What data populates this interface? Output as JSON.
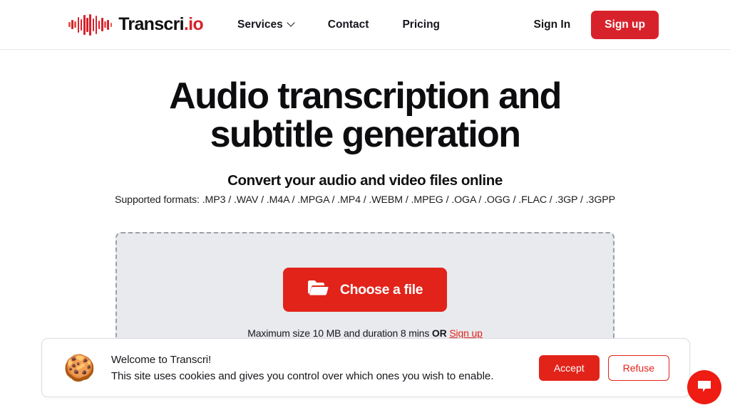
{
  "header": {
    "logo": {
      "icon": "audio-waveform-icon",
      "name_primary": "Transcri",
      "name_suffix": ".io"
    },
    "nav": [
      {
        "label": "Services",
        "icon": "chevron-down-icon",
        "has_dropdown": true
      },
      {
        "label": "Contact",
        "has_dropdown": false
      },
      {
        "label": "Pricing",
        "has_dropdown": false
      }
    ],
    "sign_in_label": "Sign In",
    "sign_up_label": "Sign up"
  },
  "hero": {
    "title_line1": "Audio transcription and",
    "title_line2": "subtitle generation",
    "subtitle": "Convert your audio and video files online",
    "formats_line": "Supported formats: .MP3 / .WAV / .M4A / .MPGA / .MP4 / .WEBM / .MPEG / .OGA / .OGG / .FLAC / .3GP / .3GPP"
  },
  "dropzone": {
    "choose_file_label": "Choose a file",
    "choose_file_icon": "open-folder-icon",
    "note_prefix": "Maximum size 10 MB and duration 8 mins ",
    "note_or": "OR",
    "note_link": "Sign up",
    "max_size": "10 MB",
    "max_duration": "8 mins"
  },
  "cookie_banner": {
    "icon": "🍪",
    "title": "Welcome to Transcri!",
    "body": "This site uses cookies and gives you control over which ones you wish to enable.",
    "accept_label": "Accept",
    "refuse_label": "Refuse"
  },
  "chat_widget": {
    "icon": "chat-bubble-icon"
  },
  "colors": {
    "brand_red": "#d8222b",
    "action_red": "#e2231a",
    "chat_red": "#ee1c12",
    "dropzone_bg": "#e8eaee",
    "dropzone_border": "#9aa0a6",
    "text_dark": "#16181d"
  }
}
